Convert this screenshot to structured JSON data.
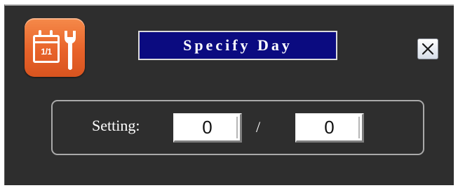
{
  "dialog": {
    "title": "Specify Day",
    "app_icon": {
      "name": "calendar-wrench-icon",
      "calendar_text": "1/1",
      "color": "#e8632a"
    },
    "close_icon": "close-icon",
    "title_background": "#0b0b80"
  },
  "setting": {
    "label": "Setting:",
    "first_value": "0",
    "separator": "/",
    "second_value": "0"
  }
}
